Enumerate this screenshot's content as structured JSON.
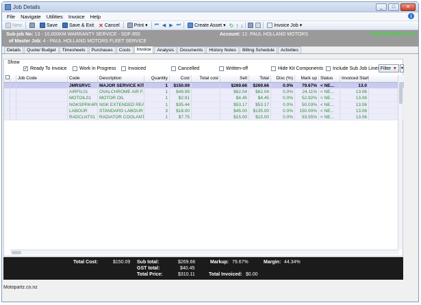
{
  "window": {
    "title": "Job Details",
    "minimize": "_",
    "maximize": "□",
    "close": "✕"
  },
  "menu": [
    "File",
    "Navigate",
    "Utilities",
    "Invoice",
    "Help"
  ],
  "toolbar": {
    "new": "New",
    "save": "Save",
    "save_exit": "Save & Exit",
    "cancel": "Cancel",
    "print": "Print",
    "create_asset": "Create Asset",
    "invoice_job": "Invoice Job"
  },
  "header": {
    "subjob_label": "Sub-job No:",
    "subjob_value": "13 - 10,000KM WARRANTY SERVICE - SDF-855",
    "master_label": "of Master Job:",
    "master_value": "4 - PAUL HOLLAND MOTORS FLEET SERVICE",
    "account_label": "Account:",
    "account_value": "12. PAUL HOLLAND MOTORS",
    "status": "Sub-Job Status: 10"
  },
  "tabs": [
    "Details",
    "Quote/ Budget",
    "Timesheets",
    "Purchases",
    "Costs",
    "Invoice",
    "Analysis",
    "Documents",
    "History Notes",
    "Billing Schedule",
    "Activities"
  ],
  "filters": {
    "show_label": "Show",
    "ready_to_invoice": "Ready To Invoice",
    "work_in_progress": "Work in Progress",
    "invoiced": "Invoiced",
    "cancelled": "Cancelled",
    "written_off": "Written-off",
    "hide_kit": "Hide Kit Components",
    "include_sub": "Include Sub Job Lines",
    "filter_button": "Filter"
  },
  "table": {
    "columns": [
      "Job Code",
      "Code",
      "Description",
      "Quantity",
      "Cost",
      "Total cost",
      "Sell",
      "Total",
      "Disc (%)",
      "Mark up",
      "Status",
      "Invoiced Start Date"
    ],
    "rows": [
      [
        "",
        "JMRSRVC",
        "MAJOR SERVICE KIT",
        "1",
        "$150.09",
        "",
        "$269.66",
        "$269.66",
        "0.0%",
        "79.67%",
        "< NE...",
        "13.0"
      ],
      [
        "",
        "AIRFIL01",
        "OVALCHROME AIR F...",
        "1",
        "$49.99",
        "",
        "$62.04",
        "$62.04",
        "0.0%",
        "24.11%",
        "< NE...",
        "13.06"
      ],
      [
        "",
        "MOTOIL01",
        "MOTOR OIL",
        "1",
        "$2.91",
        "",
        "$4.45",
        "$4.45",
        "0.0%",
        "52.92%",
        "< NE...",
        "13.06"
      ],
      [
        "",
        "NGKSPRK4PK",
        "NGK EXTENDED REA...",
        "1",
        "$35.44",
        "",
        "$53.17",
        "$53.17",
        "0.0%",
        "50.03%",
        "< NE...",
        "13.06"
      ],
      [
        "",
        "LABOUR",
        "STANDARD LABOUR ...",
        "3",
        "$18.00",
        "",
        "$45.00",
        "$135.00",
        "0.0%",
        "150.00%",
        "< NE...",
        "13.06"
      ],
      [
        "",
        "RADCLNT01",
        "RADIATOR COOLANT",
        "1",
        "$7.75",
        "",
        "$15.00",
        "$15.00",
        "0.0%",
        "93.55%",
        "< NE...",
        "13.06"
      ]
    ]
  },
  "totals": {
    "total_cost_label": "Total Cost:",
    "total_cost": "$150.09",
    "sub_total_label": "Sub total:",
    "sub_total": "$269.66",
    "gst_label": "GST total:",
    "gst": "$40.45",
    "total_price_label": "Total Price:",
    "total_price": "$310.11",
    "markup_label": "Markup:",
    "markup": "79.67%",
    "margin_label": "Margin:",
    "margin": "44.34%",
    "total_invoiced_label": "Total Invoiced:",
    "total_invoiced": "$0.00"
  },
  "footer": "Motopartz.co.nz"
}
